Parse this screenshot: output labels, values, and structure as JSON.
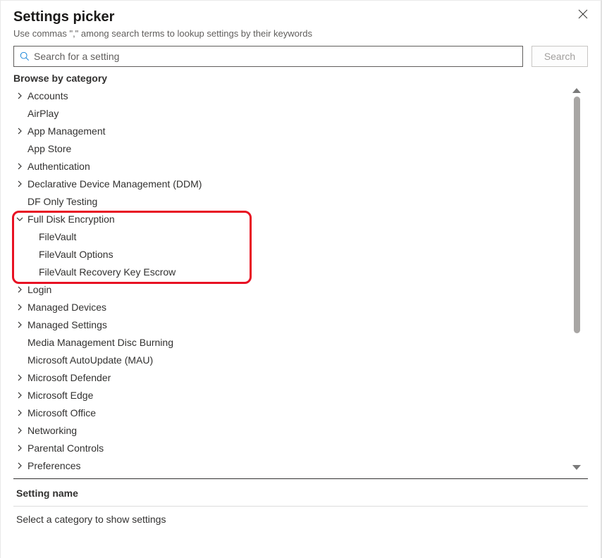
{
  "header": {
    "title": "Settings picker",
    "subtitle": "Use commas \",\" among search terms to lookup settings by their keywords"
  },
  "search": {
    "placeholder": "Search for a setting",
    "button_label": "Search"
  },
  "browse_label": "Browse by category",
  "tree": [
    {
      "label": "Accounts",
      "expandable": true,
      "expanded": false
    },
    {
      "label": "AirPlay",
      "expandable": false
    },
    {
      "label": "App Management",
      "expandable": true,
      "expanded": false
    },
    {
      "label": "App Store",
      "expandable": false
    },
    {
      "label": "Authentication",
      "expandable": true,
      "expanded": false
    },
    {
      "label": "Declarative Device Management (DDM)",
      "expandable": true,
      "expanded": false
    },
    {
      "label": "DF Only Testing",
      "expandable": false
    },
    {
      "label": "Full Disk Encryption",
      "expandable": true,
      "expanded": true,
      "children": [
        {
          "label": "FileVault"
        },
        {
          "label": "FileVault Options"
        },
        {
          "label": "FileVault Recovery Key Escrow"
        }
      ]
    },
    {
      "label": "Login",
      "expandable": true,
      "expanded": false
    },
    {
      "label": "Managed Devices",
      "expandable": true,
      "expanded": false
    },
    {
      "label": "Managed Settings",
      "expandable": true,
      "expanded": false
    },
    {
      "label": "Media Management Disc Burning",
      "expandable": false
    },
    {
      "label": "Microsoft AutoUpdate (MAU)",
      "expandable": false
    },
    {
      "label": "Microsoft Defender",
      "expandable": true,
      "expanded": false
    },
    {
      "label": "Microsoft Edge",
      "expandable": true,
      "expanded": false
    },
    {
      "label": "Microsoft Office",
      "expandable": true,
      "expanded": false
    },
    {
      "label": "Networking",
      "expandable": true,
      "expanded": false
    },
    {
      "label": "Parental Controls",
      "expandable": true,
      "expanded": false
    },
    {
      "label": "Preferences",
      "expandable": true,
      "expanded": false
    }
  ],
  "setting_name_header": "Setting name",
  "empty_message": "Select a category to show settings"
}
